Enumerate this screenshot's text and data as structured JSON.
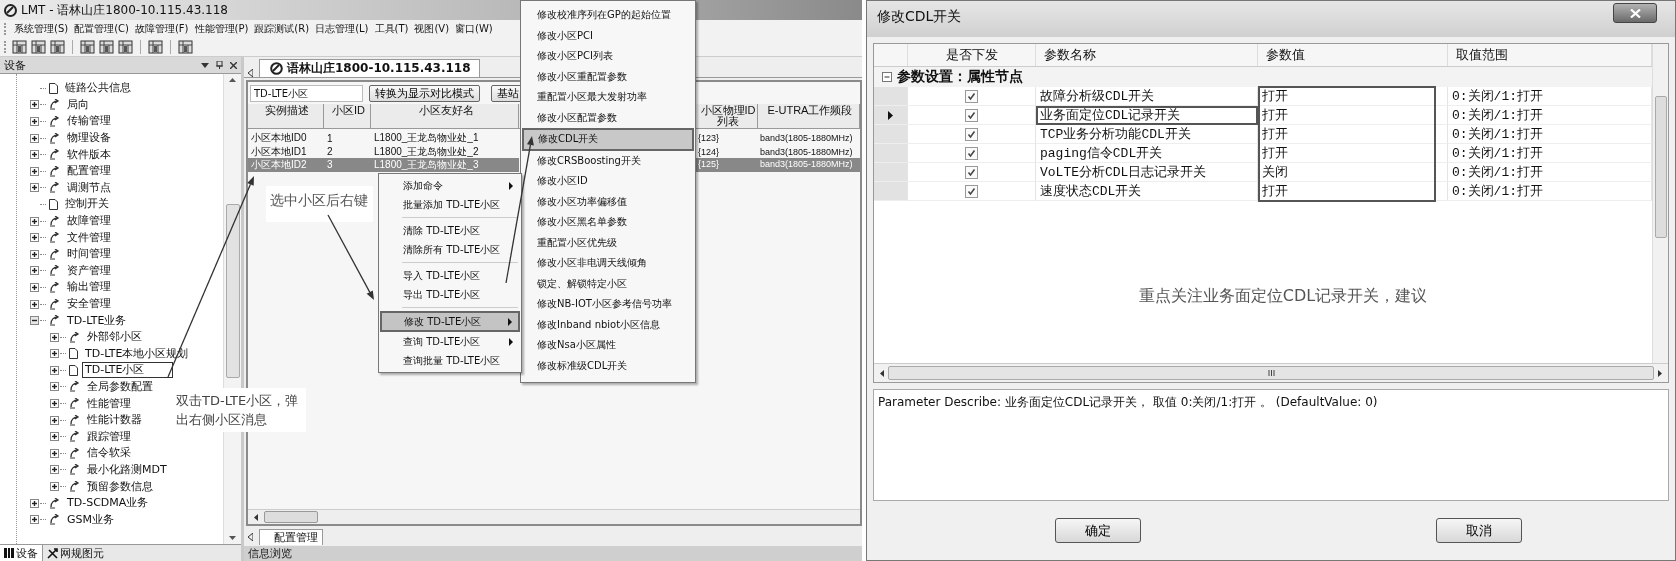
{
  "app": {
    "title": "LMT - 语林山庄1800-10.115.43.118",
    "menu": [
      "系统管理(S)",
      "配置管理(C)",
      "故障管理(F)",
      "性能管理(P)",
      "跟踪测试(R)",
      "日志管理(L)",
      "工具(T)",
      "视图(V)",
      "窗口(W)"
    ],
    "device_panel": {
      "title": "设备",
      "tree": [
        {
          "label": "链路公共信息",
          "kind": "leaf",
          "selected": false
        },
        {
          "label": "局向",
          "kind": "folder",
          "expanded": false,
          "selected": false
        },
        {
          "label": "传输管理",
          "kind": "folder",
          "expanded": false,
          "selected": false
        },
        {
          "label": "物理设备",
          "kind": "folder",
          "expanded": false,
          "selected": false
        },
        {
          "label": "软件版本",
          "kind": "folder",
          "expanded": false,
          "selected": false
        },
        {
          "label": "配置管理",
          "kind": "folder",
          "expanded": false,
          "selected": false
        },
        {
          "label": "调测节点",
          "kind": "folder",
          "expanded": false,
          "selected": false
        },
        {
          "label": "控制开关",
          "kind": "leaf",
          "selected": false
        },
        {
          "label": "故障管理",
          "kind": "folder",
          "expanded": false,
          "selected": false
        },
        {
          "label": "文件管理",
          "kind": "folder",
          "expanded": false,
          "selected": false
        },
        {
          "label": "时间管理",
          "kind": "folder",
          "expanded": false,
          "selected": false
        },
        {
          "label": "资产管理",
          "kind": "folder",
          "expanded": false,
          "selected": false
        },
        {
          "label": "输出管理",
          "kind": "folder",
          "expanded": false,
          "selected": false
        },
        {
          "label": "安全管理",
          "kind": "folder",
          "expanded": false,
          "selected": false
        },
        {
          "label": "TD-LTE业务",
          "kind": "folder",
          "expanded": true,
          "selected": false,
          "children": [
            {
              "label": "外部邻小区",
              "kind": "folder",
              "expanded": false,
              "selected": false
            },
            {
              "label": "TD-LTE本地小区规划",
              "kind": "page",
              "expanded": false,
              "selected": false
            },
            {
              "label": "TD-LTE小区",
              "kind": "page",
              "expanded": false,
              "selected": true
            },
            {
              "label": "全局参数配置",
              "kind": "folder",
              "expanded": false,
              "selected": false
            },
            {
              "label": "性能管理",
              "kind": "folder",
              "expanded": false,
              "selected": false
            },
            {
              "label": "性能计数器",
              "kind": "folder",
              "expanded": false,
              "selected": false
            },
            {
              "label": "跟踪管理",
              "kind": "folder",
              "expanded": false,
              "selected": false
            },
            {
              "label": "信令软采",
              "kind": "folder",
              "expanded": false,
              "selected": false
            },
            {
              "label": "最小化路测MDT",
              "kind": "folder",
              "expanded": false,
              "selected": false
            },
            {
              "label": "预留参数信息",
              "kind": "folder",
              "expanded": false,
              "selected": false
            }
          ]
        },
        {
          "label": "TD-SCDMA业务",
          "kind": "folder",
          "expanded": false,
          "selected": false
        },
        {
          "label": "GSM业务",
          "kind": "folder",
          "expanded": false,
          "selected": false
        }
      ],
      "tabs": [
        {
          "label": "设备",
          "selected": true
        },
        {
          "label": "网规图元",
          "selected": false
        }
      ]
    },
    "document_tab": {
      "label": "语林山庄1800-10.115.43.118",
      "selected": true
    },
    "cell_view": {
      "title_field": "TD-LTE小区",
      "buttons": [
        "转换为显示对比模式",
        "基站"
      ],
      "columns": [
        "实例描述",
        "小区ID",
        "小区友好名",
        "小区物理ID列表",
        "E-UTRA工作频段"
      ],
      "rows": [
        {
          "cells": [
            "小区本地ID0",
            "1",
            "L1800_王龙岛物业处_1",
            "{123}",
            "band3(1805-1880MHz)"
          ],
          "selected": false
        },
        {
          "cells": [
            "小区本地ID1",
            "2",
            "L1800_王龙岛物业处_2",
            "{124}",
            "band3(1805-1880MHz)"
          ],
          "selected": false
        },
        {
          "cells": [
            "小区本地ID2",
            "3",
            "L1800_王龙岛物业处_3",
            "{125}",
            "band3(1805-1880MHz)"
          ],
          "selected": true
        }
      ]
    },
    "context_menu": [
      {
        "kind": "item",
        "label": "添加命令",
        "submenu": true,
        "selected": false
      },
      {
        "kind": "item",
        "label": "批量添加 TD-LTE小区",
        "submenu": false,
        "selected": false
      },
      {
        "kind": "separator"
      },
      {
        "kind": "item",
        "label": "清除 TD-LTE小区",
        "submenu": false,
        "selected": false
      },
      {
        "kind": "item",
        "label": "清除所有 TD-LTE小区",
        "submenu": false,
        "selected": false
      },
      {
        "kind": "separator"
      },
      {
        "kind": "item",
        "label": "导入 TD-LTE小区",
        "submenu": false,
        "selected": false
      },
      {
        "kind": "item",
        "label": "导出 TD-LTE小区",
        "submenu": false,
        "selected": false
      },
      {
        "kind": "separator"
      },
      {
        "kind": "item",
        "label": "修改 TD-LTE小区",
        "submenu": true,
        "selected": true
      },
      {
        "kind": "item",
        "label": "查询 TD-LTE小区",
        "submenu": true,
        "selected": false
      },
      {
        "kind": "item",
        "label": "查询批量 TD-LTE小区",
        "submenu": false,
        "selected": false
      }
    ],
    "submenu": [
      {
        "label": "修改校准序列在GP的起始位置",
        "selected": false
      },
      {
        "label": "修改小区PCI",
        "selected": false
      },
      {
        "label": "修改小区PCI列表",
        "selected": false
      },
      {
        "label": "修改小区重配置参数",
        "selected": false
      },
      {
        "label": "重配置小区最大发射功率",
        "selected": false
      },
      {
        "label": "修改小区配置参数",
        "selected": false
      },
      {
        "label": "修改CDL开关",
        "selected": true
      },
      {
        "label": "修改CRSBoosting开关",
        "selected": false
      },
      {
        "label": "修改小区ID",
        "selected": false
      },
      {
        "label": "修改小区功率偏移值",
        "selected": false
      },
      {
        "label": "修改小区黑名单参数",
        "selected": false
      },
      {
        "label": "重配置小区优先级",
        "selected": false
      },
      {
        "label": "修改小区非电调天线倾角",
        "selected": false
      },
      {
        "label": "锁定、解锁特定小区",
        "selected": false
      },
      {
        "label": "修改NB-IOT小区参考信号功率",
        "selected": false
      },
      {
        "label": "修改Inband nbiot小区信息",
        "selected": false
      },
      {
        "label": "修改Nsa小区属性",
        "selected": false
      },
      {
        "label": "修改标准级CDL开关",
        "selected": false
      }
    ],
    "bottom_tabs": [
      {
        "label": "配置管理",
        "selected": true
      }
    ],
    "status_bar": "信息浏览",
    "annotations": [
      "选中小区后右键",
      "双击TD-LTE小区，弹出右侧小区消息"
    ]
  },
  "dialog": {
    "title": "修改CDL开关",
    "columns": [
      "是否下发",
      "参数名称",
      "参数值",
      "取值范围"
    ],
    "group": {
      "label": "参数设置：属性节点",
      "expanded": true
    },
    "rows": [
      {
        "checked": true,
        "name": "故障分析级CDL开关",
        "value": "打开",
        "range": "0:关闭/1:打开",
        "selected": false
      },
      {
        "checked": true,
        "name": "业务面定位CDL记录开关",
        "value": "打开",
        "range": "0:关闭/1:打开",
        "selected": true
      },
      {
        "checked": true,
        "name": "TCP业务分析功能CDL开关",
        "value": "打开",
        "range": "0:关闭/1:打开",
        "selected": false
      },
      {
        "checked": true,
        "name": "paging信令CDL开关",
        "value": "打开",
        "range": "0:关闭/1:打开",
        "selected": false
      },
      {
        "checked": true,
        "name": "VoLTE分析CDL日志记录开关",
        "value": "关闭",
        "range": "0:关闭/1:打开",
        "selected": false
      },
      {
        "checked": true,
        "name": "速度状态CDL开关",
        "value": "打开",
        "range": "0:关闭/1:打开",
        "selected": false
      }
    ],
    "note": "重点关注业务面定位CDL记录开关，建议",
    "description": "Parameter Describe: 业务面定位CDL记录开关， 取值 0:关闭/1:打开 。 (DefaultValue: 0)",
    "buttons": [
      "确定",
      "取消"
    ]
  }
}
